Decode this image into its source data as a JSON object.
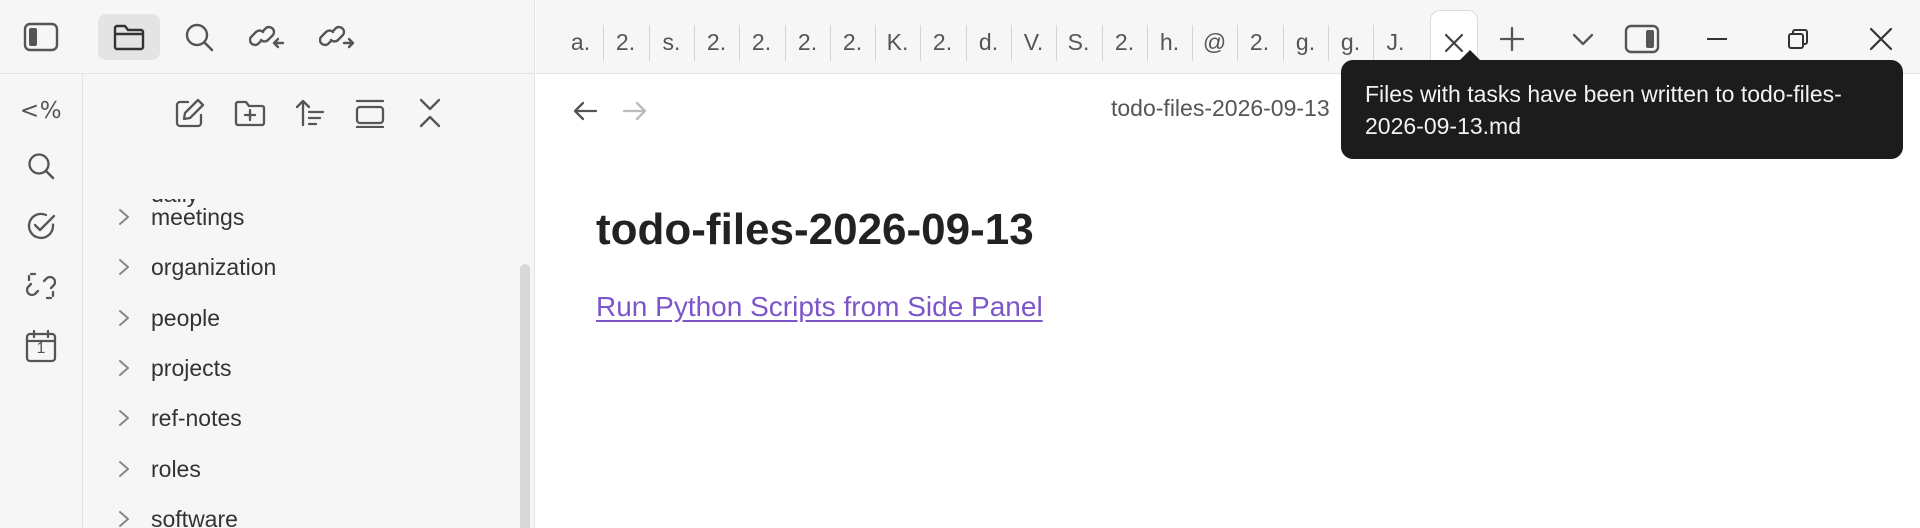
{
  "top_left": {
    "icons": [
      "sidebar-toggle-icon",
      "folder-icon",
      "search-icon",
      "link-incoming-icon",
      "link-outgoing-icon"
    ]
  },
  "ribbon": {
    "items": [
      {
        "icon": "code-text-icon",
        "text": "<%"
      },
      {
        "icon": "search-icon"
      },
      {
        "icon": "check-circle-icon"
      },
      {
        "icon": "broken-link-icon"
      },
      {
        "icon": "calendar-icon",
        "text": "1"
      }
    ]
  },
  "explorer": {
    "toolbar_icons": [
      "new-note-icon",
      "new-folder-icon",
      "sort-icon",
      "collapse-view-icon",
      "collapse-all-icon"
    ],
    "partial_item": "daily",
    "folders": [
      "meetings",
      "organization",
      "people",
      "projects",
      "ref-notes",
      "roles",
      "software"
    ]
  },
  "tabs": {
    "labels": [
      "a.",
      "2.",
      "s.",
      "2.",
      "2.",
      "2.",
      "2.",
      "K.",
      "2.",
      "d.",
      "V.",
      "S.",
      "2.",
      "h.",
      "@",
      "2.",
      "g.",
      "g.",
      "J."
    ],
    "controls": [
      "close-tab-icon",
      "plus-icon",
      "chevron-down-icon",
      "right-sidebar-icon",
      "minimize-icon",
      "restore-icon",
      "close-window-icon"
    ]
  },
  "content": {
    "view_title": "todo-files-2026-09-13",
    "doc_title": "todo-files-2026-09-13",
    "link_text": "Run Python Scripts from Side Panel",
    "link_color": "#7c56c9"
  },
  "tooltip": {
    "line1": "Files with tasks have been written to todo-files-",
    "line2": "2026-09-13.md"
  }
}
